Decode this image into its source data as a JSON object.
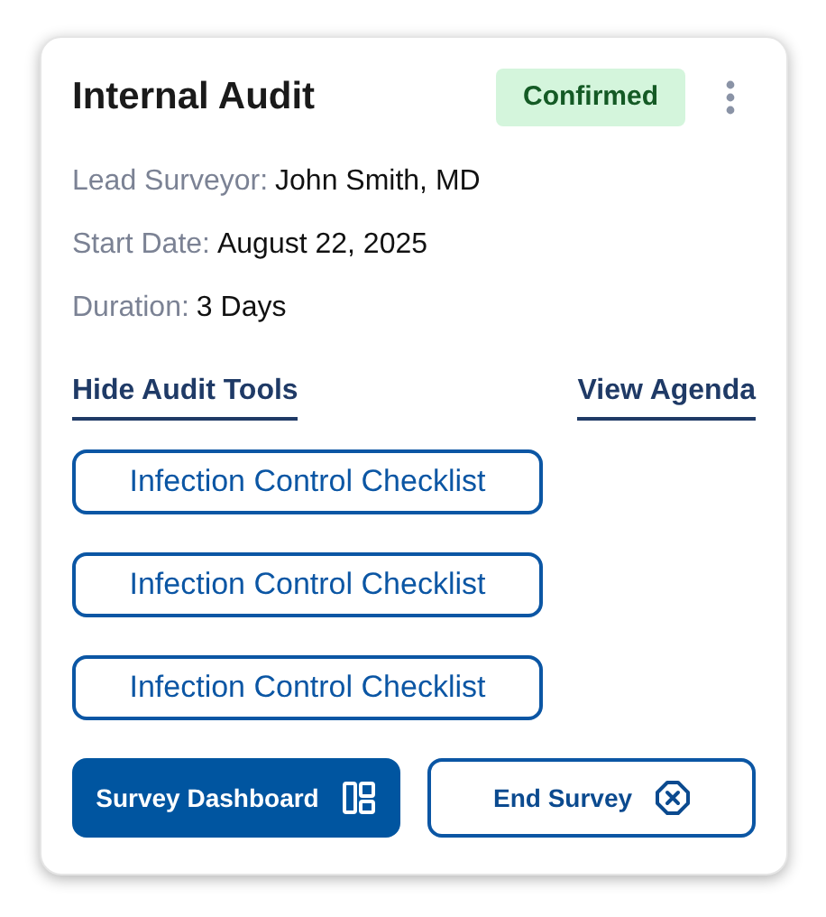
{
  "card": {
    "title": "Internal Audit",
    "status": "Confirmed"
  },
  "details": [
    {
      "label": "Lead Surveyor:",
      "value": "John Smith, MD"
    },
    {
      "label": "Start Date:",
      "value": "August 22, 2025"
    },
    {
      "label": "Duration:",
      "value": "3 Days"
    }
  ],
  "links": [
    "Hide Audit Tools",
    "View Agenda"
  ],
  "tools": [
    "Infection Control Checklist",
    "Infection Control Checklist",
    "Infection Control Checklist"
  ],
  "actions": [
    {
      "label": "Survey Dashboard",
      "kind": "primary"
    },
    {
      "label": "End Survey",
      "kind": "outline"
    }
  ]
}
